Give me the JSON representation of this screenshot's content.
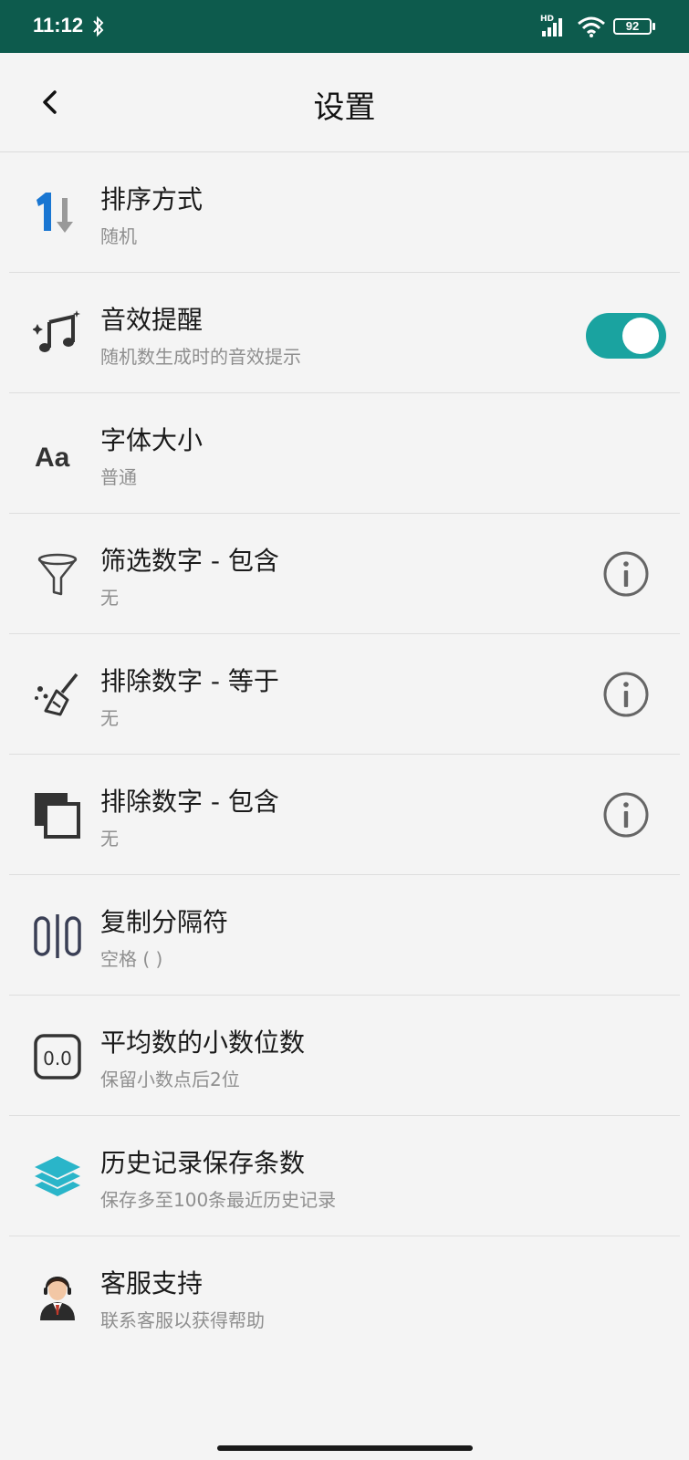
{
  "status_bar": {
    "time": "11:12",
    "battery": "92",
    "hd_label": "HD"
  },
  "header": {
    "title": "设置"
  },
  "colors": {
    "status_bar_bg": "#0d5b4d",
    "toggle_on": "#1aa3a0",
    "sort_blue": "#1976d2"
  },
  "settings": [
    {
      "label": "排序方式",
      "value": "随机",
      "icon": "sort-order-icon"
    },
    {
      "label": "音效提醒",
      "value": "随机数生成时的音效提示",
      "icon": "music-note-icon",
      "toggle_on": true
    },
    {
      "label": "字体大小",
      "value": "普通",
      "icon": "font-size-icon",
      "icon_text": "Aa"
    },
    {
      "label": "筛选数字 - 包含",
      "value": "无",
      "icon": "filter-funnel-icon"
    },
    {
      "label": "排除数字 - 等于",
      "value": "无",
      "icon": "broom-icon"
    },
    {
      "label": "排除数字 - 包含",
      "value": "无",
      "icon": "overlap-squares-icon"
    },
    {
      "label": "复制分隔符",
      "value": "空格 ( )",
      "icon": "separator-icon"
    },
    {
      "label": "平均数的小数位数",
      "value": "保留小数点后2位",
      "icon": "decimal-icon",
      "icon_text": "0.0"
    },
    {
      "label": "历史记录保存条数",
      "value": "保存多至100条最近历史记录",
      "icon": "layers-icon"
    },
    {
      "label": "客服支持",
      "value": "联系客服以获得帮助",
      "icon": "customer-service-icon"
    }
  ]
}
